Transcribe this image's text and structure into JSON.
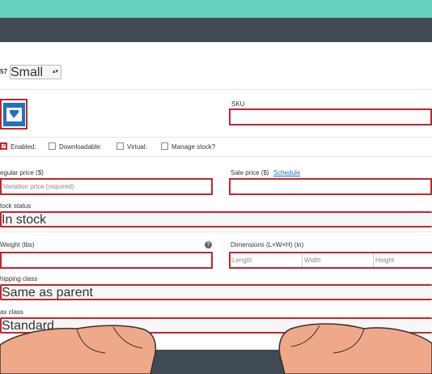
{
  "variation": {
    "id_prefix": "57",
    "size_value": "Small"
  },
  "image_button": {
    "icon": "image-icon"
  },
  "sku": {
    "label": "SKU",
    "value": ""
  },
  "options": {
    "enabled": "Enabled:",
    "downloadable": "Downloadable:",
    "virtual": "Virtual:",
    "manage_stock": "Manage stock?",
    "enabled_checked": true
  },
  "regular_price": {
    "label": "egular price ($)",
    "placeholder": "Variation price (required)"
  },
  "sale_price": {
    "label": "Sale price ($)",
    "link": "Schedule"
  },
  "stock_status": {
    "label": "tock status",
    "value": "In stock"
  },
  "weight": {
    "label": "Weight (lbs)",
    "help_icon": "help-icon"
  },
  "dimensions": {
    "label": "Dimensions (L×W×H) (in)",
    "length": "Length",
    "width": "Width",
    "height": "Height"
  },
  "shipping_class": {
    "label": "hipping class",
    "value": "Same as parent"
  },
  "tax_class": {
    "label": "ax class",
    "value": "Standard"
  }
}
